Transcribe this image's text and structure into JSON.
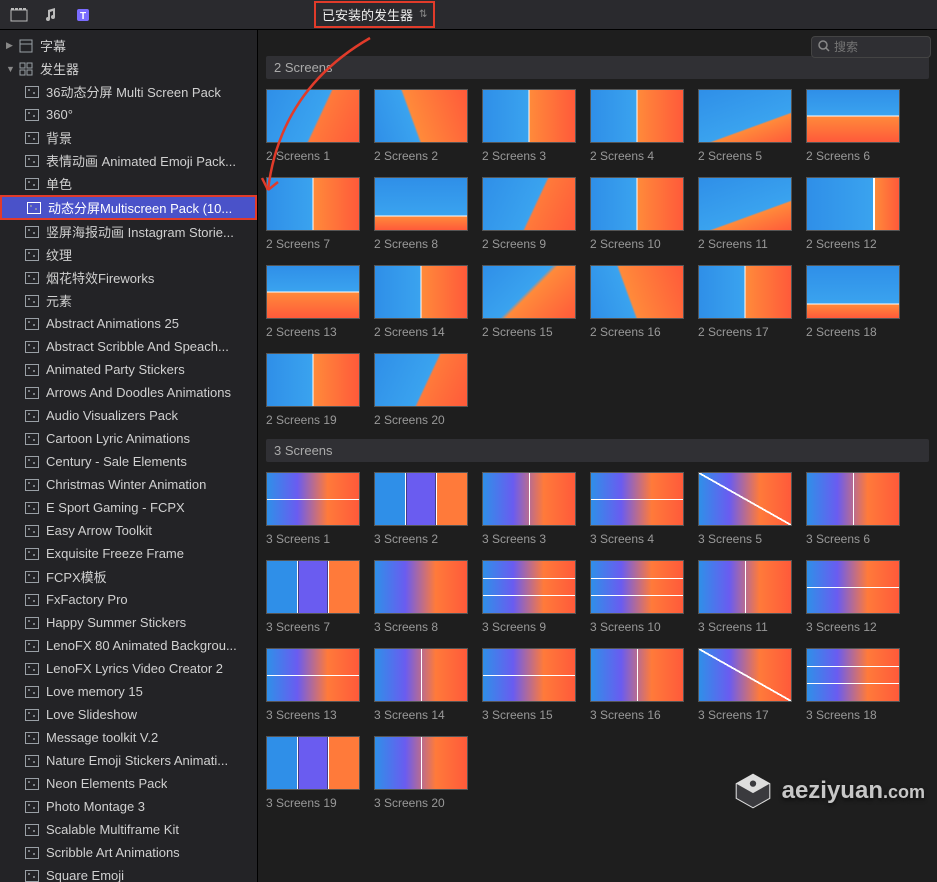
{
  "dropdown": {
    "label": "已安装的发生器"
  },
  "search": {
    "placeholder": "搜索"
  },
  "sidebar": {
    "top": [
      {
        "label": "字幕",
        "icon": "titles"
      },
      {
        "label": "发生器",
        "icon": "generators",
        "expanded": true
      }
    ],
    "items": [
      "36动态分屏 Multi Screen Pack",
      "360°",
      "背景",
      "表情动画 Animated Emoji Pack...",
      "单色",
      "动态分屏Multiscreen Pack (10...",
      "竖屏海报动画 Instagram Storie...",
      "纹理",
      "烟花特效Fireworks",
      "元素",
      "Abstract Animations 25",
      "Abstract Scribble And Speach...",
      "Animated Party Stickers",
      "Arrows And Doodles Animations",
      "Audio Visualizers Pack",
      "Cartoon Lyric Animations",
      "Century - Sale Elements",
      "Christmas Winter Animation",
      "E Sport Gaming - FCPX",
      "Easy Arrow Toolkit",
      "Exquisite Freeze Frame",
      "FCPX模板",
      "FxFactory Pro",
      "Happy Summer Stickers",
      "LenoFX 80 Animated Backgrou...",
      "LenoFX Lyrics Video Creator 2",
      "Love memory 15",
      "Love Slideshow",
      "Message toolkit V.2",
      "Nature Emoji Stickers Animati...",
      "Neon Elements Pack",
      "Photo Montage 3",
      "Scalable Multiframe Kit",
      "Scribble Art Animations",
      "Square Emoji"
    ],
    "selected_index": 5
  },
  "sections": [
    {
      "title": "2 Screens",
      "items": [
        {
          "label": "2 Screens 1",
          "style": "grad-diag"
        },
        {
          "label": "2 Screens 2",
          "style": "diag-70"
        },
        {
          "label": "2 Screens 3",
          "style": "half-v"
        },
        {
          "label": "2 Screens 4",
          "style": "half-v"
        },
        {
          "label": "2 Screens 5",
          "style": "diag-20"
        },
        {
          "label": "2 Screens 6",
          "style": "half-h"
        },
        {
          "label": "2 Screens 7",
          "style": "half-v"
        },
        {
          "label": "2 Screens 8",
          "style": "strip-bot"
        },
        {
          "label": "2 Screens 9",
          "style": "grad-diag"
        },
        {
          "label": "2 Screens 10",
          "style": "half-v"
        },
        {
          "label": "2 Screens 11",
          "style": "diag-20"
        },
        {
          "label": "2 Screens 12",
          "style": "strip-side"
        },
        {
          "label": "2 Screens 13",
          "style": "half-h"
        },
        {
          "label": "2 Screens 14",
          "style": "half-v"
        },
        {
          "label": "2 Screens 15",
          "style": "grad-br"
        },
        {
          "label": "2 Screens 16",
          "style": "diag-70"
        },
        {
          "label": "2 Screens 17",
          "style": "half-v"
        },
        {
          "label": "2 Screens 18",
          "style": "strip-bot"
        },
        {
          "label": "2 Screens 19",
          "style": "half-v"
        },
        {
          "label": "2 Screens 20",
          "style": "grad-diag"
        }
      ]
    },
    {
      "title": "3 Screens",
      "items": [
        {
          "label": "3 Screens 1",
          "style": "three-base lines-h1"
        },
        {
          "label": "3 Screens 2",
          "style": "three-v3"
        },
        {
          "label": "3 Screens 3",
          "style": "three-base lines-v1"
        },
        {
          "label": "3 Screens 4",
          "style": "three-base lines-h1"
        },
        {
          "label": "3 Screens 5",
          "style": "three-base line-d"
        },
        {
          "label": "3 Screens 6",
          "style": "three-base lines-v1"
        },
        {
          "label": "3 Screens 7",
          "style": "three-v3"
        },
        {
          "label": "3 Screens 8",
          "style": "three-base"
        },
        {
          "label": "3 Screens 9",
          "style": "three-base lines-h2"
        },
        {
          "label": "3 Screens 10",
          "style": "three-base lines-h2"
        },
        {
          "label": "3 Screens 11",
          "style": "three-base lines-v1"
        },
        {
          "label": "3 Screens 12",
          "style": "three-base lines-h1"
        },
        {
          "label": "3 Screens 13",
          "style": "three-base lines-h1"
        },
        {
          "label": "3 Screens 14",
          "style": "three-base lines-v1"
        },
        {
          "label": "3 Screens 15",
          "style": "three-base lines-h1"
        },
        {
          "label": "3 Screens 16",
          "style": "three-base lines-v1"
        },
        {
          "label": "3 Screens 17",
          "style": "three-base line-d"
        },
        {
          "label": "3 Screens 18",
          "style": "three-base lines-h2"
        },
        {
          "label": "3 Screens 19",
          "style": "three-v3"
        },
        {
          "label": "3 Screens 20",
          "style": "three-base lines-v1"
        }
      ]
    }
  ],
  "watermark": {
    "text": "aeziyuan",
    "sub": ".com"
  }
}
